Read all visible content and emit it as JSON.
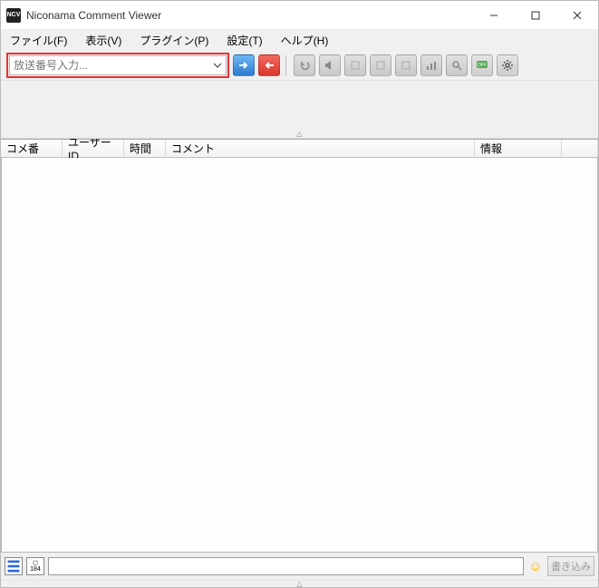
{
  "window": {
    "title": "Niconama Comment Viewer",
    "app_icon_text": "NCV"
  },
  "menu": {
    "file": "ファイル(F)",
    "view": "表示(V)",
    "plugin": "プラグイン(P)",
    "settings": "設定(T)",
    "help": "ヘルプ(H)"
  },
  "toolbar": {
    "broadcast_placeholder": "放送番号入力..."
  },
  "table": {
    "headers": {
      "num": "コメ番",
      "user": "ユーザーID",
      "time": "時間",
      "comment": "コメント",
      "info": "情報"
    }
  },
  "footer": {
    "badge184": "184",
    "submit": "書き込み"
  }
}
